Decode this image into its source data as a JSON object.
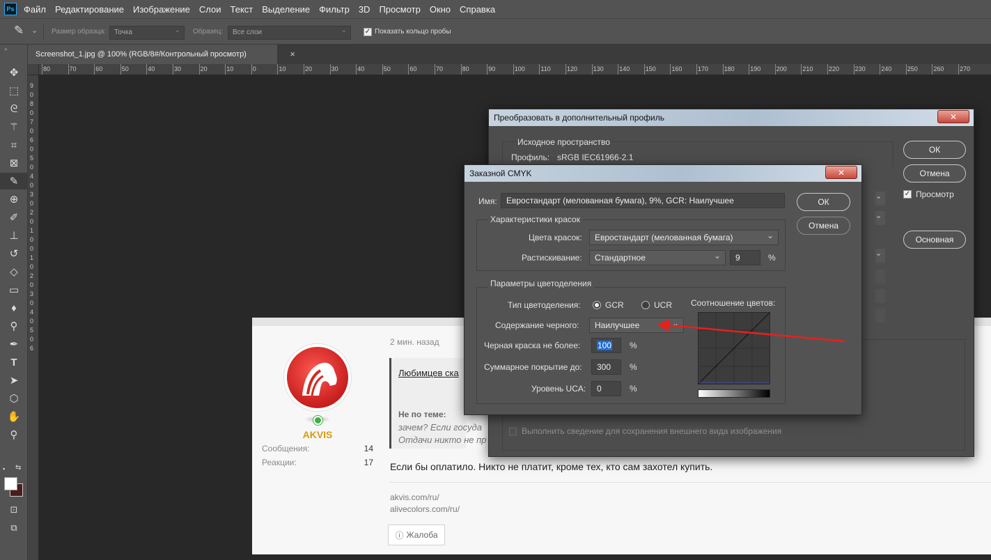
{
  "app": {
    "logo": "Ps"
  },
  "menu": [
    "Файл",
    "Редактирование",
    "Изображение",
    "Слои",
    "Текст",
    "Выделение",
    "Фильтр",
    "3D",
    "Просмотр",
    "Окно",
    "Справка"
  ],
  "options": {
    "sample_size_label": "Размер образца:",
    "sample_size_value": "Точка",
    "sample_label": "Образец:",
    "sample_value": "Все слои",
    "show_ring_label": "Показать кольцо пробы"
  },
  "document_tab": {
    "title": "Screenshot_1.jpg @ 100% (RGB/8#/Контрольный просмотр)",
    "close": "×"
  },
  "ruler": {
    "h_ticks": [
      "80",
      "70",
      "60",
      "50",
      "40",
      "30",
      "20",
      "10",
      "0",
      "10",
      "20",
      "30",
      "40",
      "50",
      "60",
      "70",
      "80",
      "90",
      "100",
      "110",
      "120",
      "130",
      "140",
      "150",
      "160",
      "170",
      "180",
      "190",
      "200",
      "210",
      "220",
      "230",
      "240",
      "250",
      "260",
      "270"
    ],
    "v_ticks": [
      "9",
      "0",
      "8",
      "0",
      "7",
      "0",
      "6",
      "0",
      "5",
      "0",
      "4",
      "0",
      "3",
      "0",
      "2",
      "0",
      "1",
      "0",
      "0",
      "1",
      "0",
      "2",
      "0",
      "3",
      "0",
      "4",
      "0",
      "5",
      "0",
      "6"
    ]
  },
  "forum": {
    "time": "2 мин. назад",
    "username": "AKVIS",
    "messages_label": "Сообщения:",
    "messages_value": "14",
    "reactions_label": "Реакции:",
    "reactions_value": "17",
    "quote_link": "Любимцев ска",
    "offtopic_label": "Не по теме:",
    "offtopic_line1": "зачем? Если госуда",
    "offtopic_line2": "Отдачи никто не пр",
    "post_text": "Если бы оплатило. Никто не платит, кроме тех, кто сам захотел купить.",
    "links": [
      "akvis.com/ru/",
      "alivecolors.com/ru/"
    ],
    "report": "Жалоба"
  },
  "profile_dialog": {
    "title": "Преобразовать в дополнительный профиль",
    "close": "✕",
    "source_group": "Исходное пространство",
    "profile_label": "Профиль:",
    "profile_value": "sRGB IEC61966-2.1",
    "ok": "ОК",
    "cancel": "Отмена",
    "preview": "Просмотр",
    "basic": "Основная",
    "flatten": "Выполнить сведение для сохранения внешнего вида изображения"
  },
  "cmyk_dialog": {
    "title": "Заказной CMYK",
    "close": "✕",
    "name_label": "Имя:",
    "name_value": "Евростандарт (мелованная бумага), 9%, GCR: Наилучшее",
    "ok": "ОК",
    "cancel": "Отмена",
    "ink_group": "Характеристики красок",
    "ink_colors_label": "Цвета красок:",
    "ink_colors_value": "Евростандарт (мелованная бумага)",
    "dot_gain_label": "Растискивание:",
    "dot_gain_value": "Стандартное",
    "dot_gain_amount": "9",
    "dot_gain_unit": "%",
    "sep_group": "Параметры цветоделения",
    "sep_type_label": "Тип цветоделения:",
    "gcr": "GCR",
    "ucr": "UCR",
    "black_gen_label": "Содержание черного:",
    "black_gen_value": "Наилучшее",
    "black_limit_label": "Черная краска не более:",
    "black_limit_value": "100",
    "black_limit_unit": "%",
    "total_ink_label": "Суммарное покрытие до:",
    "total_ink_value": "300",
    "total_ink_unit": "%",
    "uca_label": "Уровень UCA:",
    "uca_value": "0",
    "uca_unit": "%",
    "graph_label": "Соотношение цветов:"
  },
  "colors": {
    "arrow": "#e8201e",
    "accent": "#31a8ff",
    "online": "#3fae49",
    "username": "#d79b12"
  }
}
